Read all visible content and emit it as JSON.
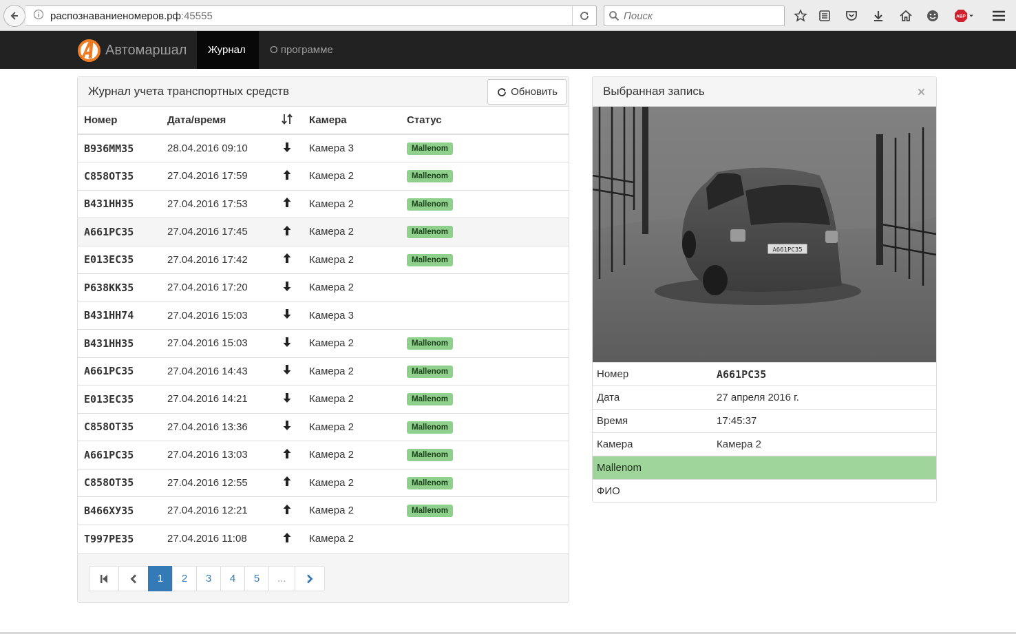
{
  "browser": {
    "url_host": "распознаваниеномеров.рф",
    "url_port": ":45555",
    "search_placeholder": "Поиск",
    "toolbar_icons": [
      "star-icon",
      "reading-list-icon",
      "pocket-icon",
      "download-icon",
      "home-icon",
      "smiley-icon",
      "adblock-icon",
      "menu-icon"
    ],
    "adblock_label": "ABP"
  },
  "navbar": {
    "brand": "Автомаршал",
    "items": [
      {
        "label": "Журнал",
        "active": true
      },
      {
        "label": "О программе",
        "active": false
      }
    ]
  },
  "journal": {
    "title": "Журнал учета транспортных средств",
    "refresh_label": "Обновить",
    "columns": [
      "Номер",
      "Дата/время",
      "",
      "Камера",
      "Статус"
    ],
    "rows": [
      {
        "plate": "В936ММ35",
        "datetime": "28.04.2016 09:10",
        "direction": "down",
        "camera": "Камера 3",
        "status": "Mallenom"
      },
      {
        "plate": "С858ОТ35",
        "datetime": "27.04.2016 17:59",
        "direction": "up",
        "camera": "Камера 2",
        "status": "Mallenom"
      },
      {
        "plate": "В431НН35",
        "datetime": "27.04.2016 17:53",
        "direction": "up",
        "camera": "Камера 2",
        "status": "Mallenom"
      },
      {
        "plate": "А661РС35",
        "datetime": "27.04.2016 17:45",
        "direction": "up",
        "camera": "Камера 2",
        "status": "Mallenom"
      },
      {
        "plate": "Е013ЕС35",
        "datetime": "27.04.2016 17:42",
        "direction": "up",
        "camera": "Камера 2",
        "status": "Mallenom"
      },
      {
        "plate": "Р638КК35",
        "datetime": "27.04.2016 17:20",
        "direction": "down",
        "camera": "Камера 2",
        "status": ""
      },
      {
        "plate": "В431НН74",
        "datetime": "27.04.2016 15:03",
        "direction": "down",
        "camera": "Камера 3",
        "status": ""
      },
      {
        "plate": "В431НН35",
        "datetime": "27.04.2016 15:03",
        "direction": "down",
        "camera": "Камера 2",
        "status": "Mallenom"
      },
      {
        "plate": "А661РС35",
        "datetime": "27.04.2016 14:43",
        "direction": "down",
        "camera": "Камера 2",
        "status": "Mallenom"
      },
      {
        "plate": "Е013ЕС35",
        "datetime": "27.04.2016 14:21",
        "direction": "down",
        "camera": "Камера 2",
        "status": "Mallenom"
      },
      {
        "plate": "С858ОТ35",
        "datetime": "27.04.2016 13:36",
        "direction": "down",
        "camera": "Камера 2",
        "status": "Mallenom"
      },
      {
        "plate": "А661РС35",
        "datetime": "27.04.2016 13:03",
        "direction": "up",
        "camera": "Камера 2",
        "status": "Mallenom"
      },
      {
        "plate": "С858ОТ35",
        "datetime": "27.04.2016 12:55",
        "direction": "up",
        "camera": "Камера 2",
        "status": "Mallenom"
      },
      {
        "plate": "В466ХУ35",
        "datetime": "27.04.2016 12:21",
        "direction": "up",
        "camera": "Камера 2",
        "status": "Mallenom"
      },
      {
        "plate": "Т997РЕ35",
        "datetime": "27.04.2016 11:08",
        "direction": "up",
        "camera": "Камера 2",
        "status": ""
      }
    ],
    "selected_row": 3,
    "pagination": {
      "pages": [
        "1",
        "2",
        "3",
        "4",
        "5",
        "..."
      ],
      "active": "1"
    }
  },
  "detail": {
    "title": "Выбранная запись",
    "close": "×",
    "photo_plate_text": "А661РС35",
    "fields": [
      {
        "label": "Номер",
        "value": "А661РС35"
      },
      {
        "label": "Дата",
        "value": "27 апреля 2016 г."
      },
      {
        "label": "Время",
        "value": "17:45:37"
      },
      {
        "label": "Камера",
        "value": "Камера 2"
      }
    ],
    "status": "Mallenom",
    "fio_label": "ФИО",
    "fio_value": ""
  }
}
